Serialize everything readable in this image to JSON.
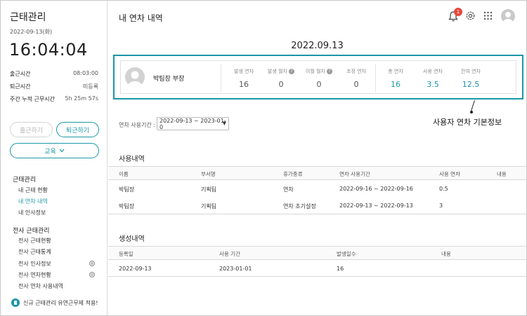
{
  "sidebar": {
    "title": "근태관리",
    "date": "2022-09-13(화)",
    "clock": "16:04:04",
    "rows": [
      {
        "label": "출근시간",
        "value": "08:03:00"
      },
      {
        "label": "퇴근시간",
        "value": "미등록"
      },
      {
        "label": "주간 누적 근무시간",
        "value": "5h 25m 57s"
      }
    ],
    "btn_checkin": "출근하기",
    "btn_checkout": "퇴근하기",
    "btn_edu": "교육",
    "nav_group1": "근태관리",
    "nav1": [
      "내 근태 현황",
      "내 연차 내역",
      "내 인사정보"
    ],
    "nav_group2": "전사 근태관리",
    "nav2": [
      "전사 근태현황",
      "전사 근태통계",
      "전사 인사정보",
      "전사 연차현황",
      "전사 연차 사용내역"
    ],
    "promo": "신규 근태관리 유연근무제 적용!"
  },
  "header": {
    "title": "내 연차 내역",
    "notification_count": "1",
    "icons": [
      "bell-icon",
      "gear-icon",
      "apps-grid-icon",
      "avatar"
    ]
  },
  "summary": {
    "date": "2022.09.13",
    "name": "박팀장 부장",
    "stats": [
      {
        "label": "발생 연차",
        "value": "16",
        "help": false
      },
      {
        "label": "발생 월차",
        "value": "0",
        "help": true
      },
      {
        "label": "이월 월차",
        "value": "0",
        "help": true
      },
      {
        "label": "조정 연차",
        "value": "0",
        "help": false
      },
      {
        "label": "총 연차",
        "value": "16",
        "help": false
      },
      {
        "label": "사용 연차",
        "value": "3.5",
        "help": false
      },
      {
        "label": "잔여 연차",
        "value": "12.5",
        "help": false
      }
    ],
    "help_glyph": "?",
    "callout": "사용자 연차 기본정보"
  },
  "filter": {
    "label": "연차 사용기간 :",
    "value": "2022-09-13 ~ 2023-01-0"
  },
  "usage": {
    "title": "사용내역",
    "headers": [
      "이름",
      "부서명",
      "휴가종류",
      "연차 사용기간",
      "사용 연차",
      "내용"
    ],
    "rows": [
      [
        "박팀장",
        "기획팀",
        "연차",
        "2022-09-16 ~ 2022-09-16",
        "0.5",
        ""
      ],
      [
        "박팀장",
        "기획팀",
        "연차 초기설정",
        "2022-09-13 ~ 2022-09-13",
        "3",
        ""
      ]
    ]
  },
  "creation": {
    "title": "생성내역",
    "headers": [
      "등록일",
      "사용 기간",
      "발생일수",
      "내용"
    ],
    "rows": [
      [
        "2022-09-13",
        "2023-01-01",
        "16",
        ""
      ]
    ]
  },
  "colors": {
    "accent": "#1a97a6",
    "badge": "#e64a3c"
  }
}
